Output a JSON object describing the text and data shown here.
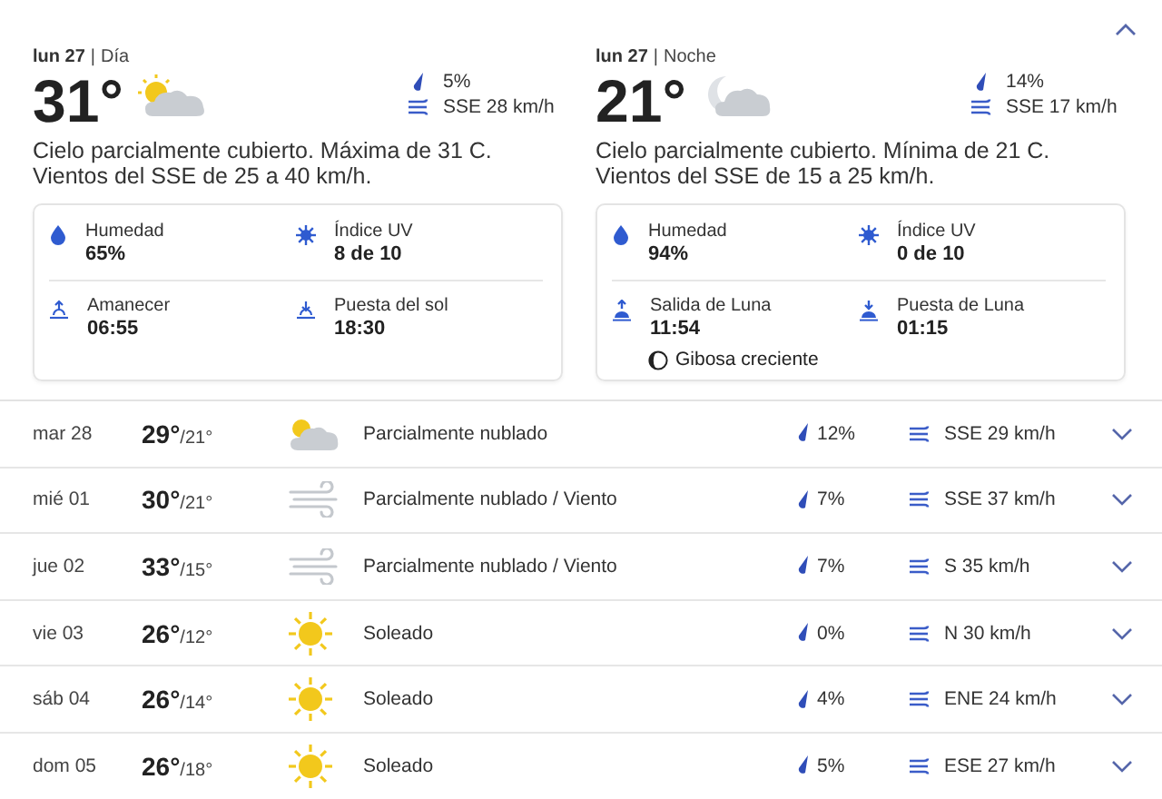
{
  "summary": {
    "expanded": true,
    "periods": [
      {
        "date": "lun 27",
        "separator": "|",
        "period": "Día",
        "temperature": "31°",
        "kind": "partly-cloudy-day",
        "precipitation": "5%",
        "wind": "SSE 28 km/h",
        "description": "Cielo parcialmente cubierto. Máxima de 31 C. Vientos del SSE de 25 a 40 km/h.",
        "details": [
          {
            "kind": "humidity",
            "label": "Humedad",
            "value": "65%"
          },
          {
            "kind": "uv",
            "label": "Índice UV",
            "value": "8 de 10"
          },
          {
            "kind": "sunrise",
            "label": "Amanecer",
            "value": "06:55"
          },
          {
            "kind": "sunset",
            "label": "Puesta del sol",
            "value": "18:30"
          }
        ]
      },
      {
        "date": "lun 27",
        "separator": "|",
        "period": "Noche",
        "temperature": "21°",
        "kind": "partly-cloudy-night",
        "precipitation": "14%",
        "wind": "SSE 17 km/h",
        "description": "Cielo parcialmente cubierto. Mínima de 21 C. Vientos del SSE de 15 a 25 km/h.",
        "details": [
          {
            "kind": "humidity",
            "label": "Humedad",
            "value": "94%"
          },
          {
            "kind": "uv",
            "label": "Índice UV",
            "value": "0 de 10"
          },
          {
            "kind": "moonrise",
            "label": "Salida de Luna",
            "value": "11:54"
          },
          {
            "kind": "moonset",
            "label": "Puesta de Luna",
            "value": "01:15"
          }
        ],
        "moon_phase": "Gibosa creciente"
      }
    ]
  },
  "days": [
    {
      "day": "mar 28",
      "high": "29°",
      "low": "/21°",
      "kind": "partly-cloudy",
      "condition": "Parcialmente nublado",
      "precipitation": "12%",
      "wind": "SSE 29 km/h",
      "expanded": false
    },
    {
      "day": "mié 01",
      "high": "30°",
      "low": "/21°",
      "kind": "wind",
      "condition": "Parcialmente nublado / Viento",
      "precipitation": "7%",
      "wind": "SSE 37 km/h",
      "expanded": false
    },
    {
      "day": "jue 02",
      "high": "33°",
      "low": "/15°",
      "kind": "wind",
      "condition": "Parcialmente nublado / Viento",
      "precipitation": "7%",
      "wind": "S 35 km/h",
      "expanded": false
    },
    {
      "day": "vie 03",
      "high": "26°",
      "low": "/12°",
      "kind": "sunny",
      "condition": "Soleado",
      "precipitation": "0%",
      "wind": "N 30 km/h",
      "expanded": false
    },
    {
      "day": "sáb 04",
      "high": "26°",
      "low": "/14°",
      "kind": "sunny",
      "condition": "Soleado",
      "precipitation": "4%",
      "wind": "ENE 24 km/h",
      "expanded": false
    },
    {
      "day": "dom 05",
      "high": "26°",
      "low": "/18°",
      "kind": "sunny",
      "condition": "Soleado",
      "precipitation": "5%",
      "wind": "ESE 27 km/h",
      "expanded": false
    }
  ]
}
